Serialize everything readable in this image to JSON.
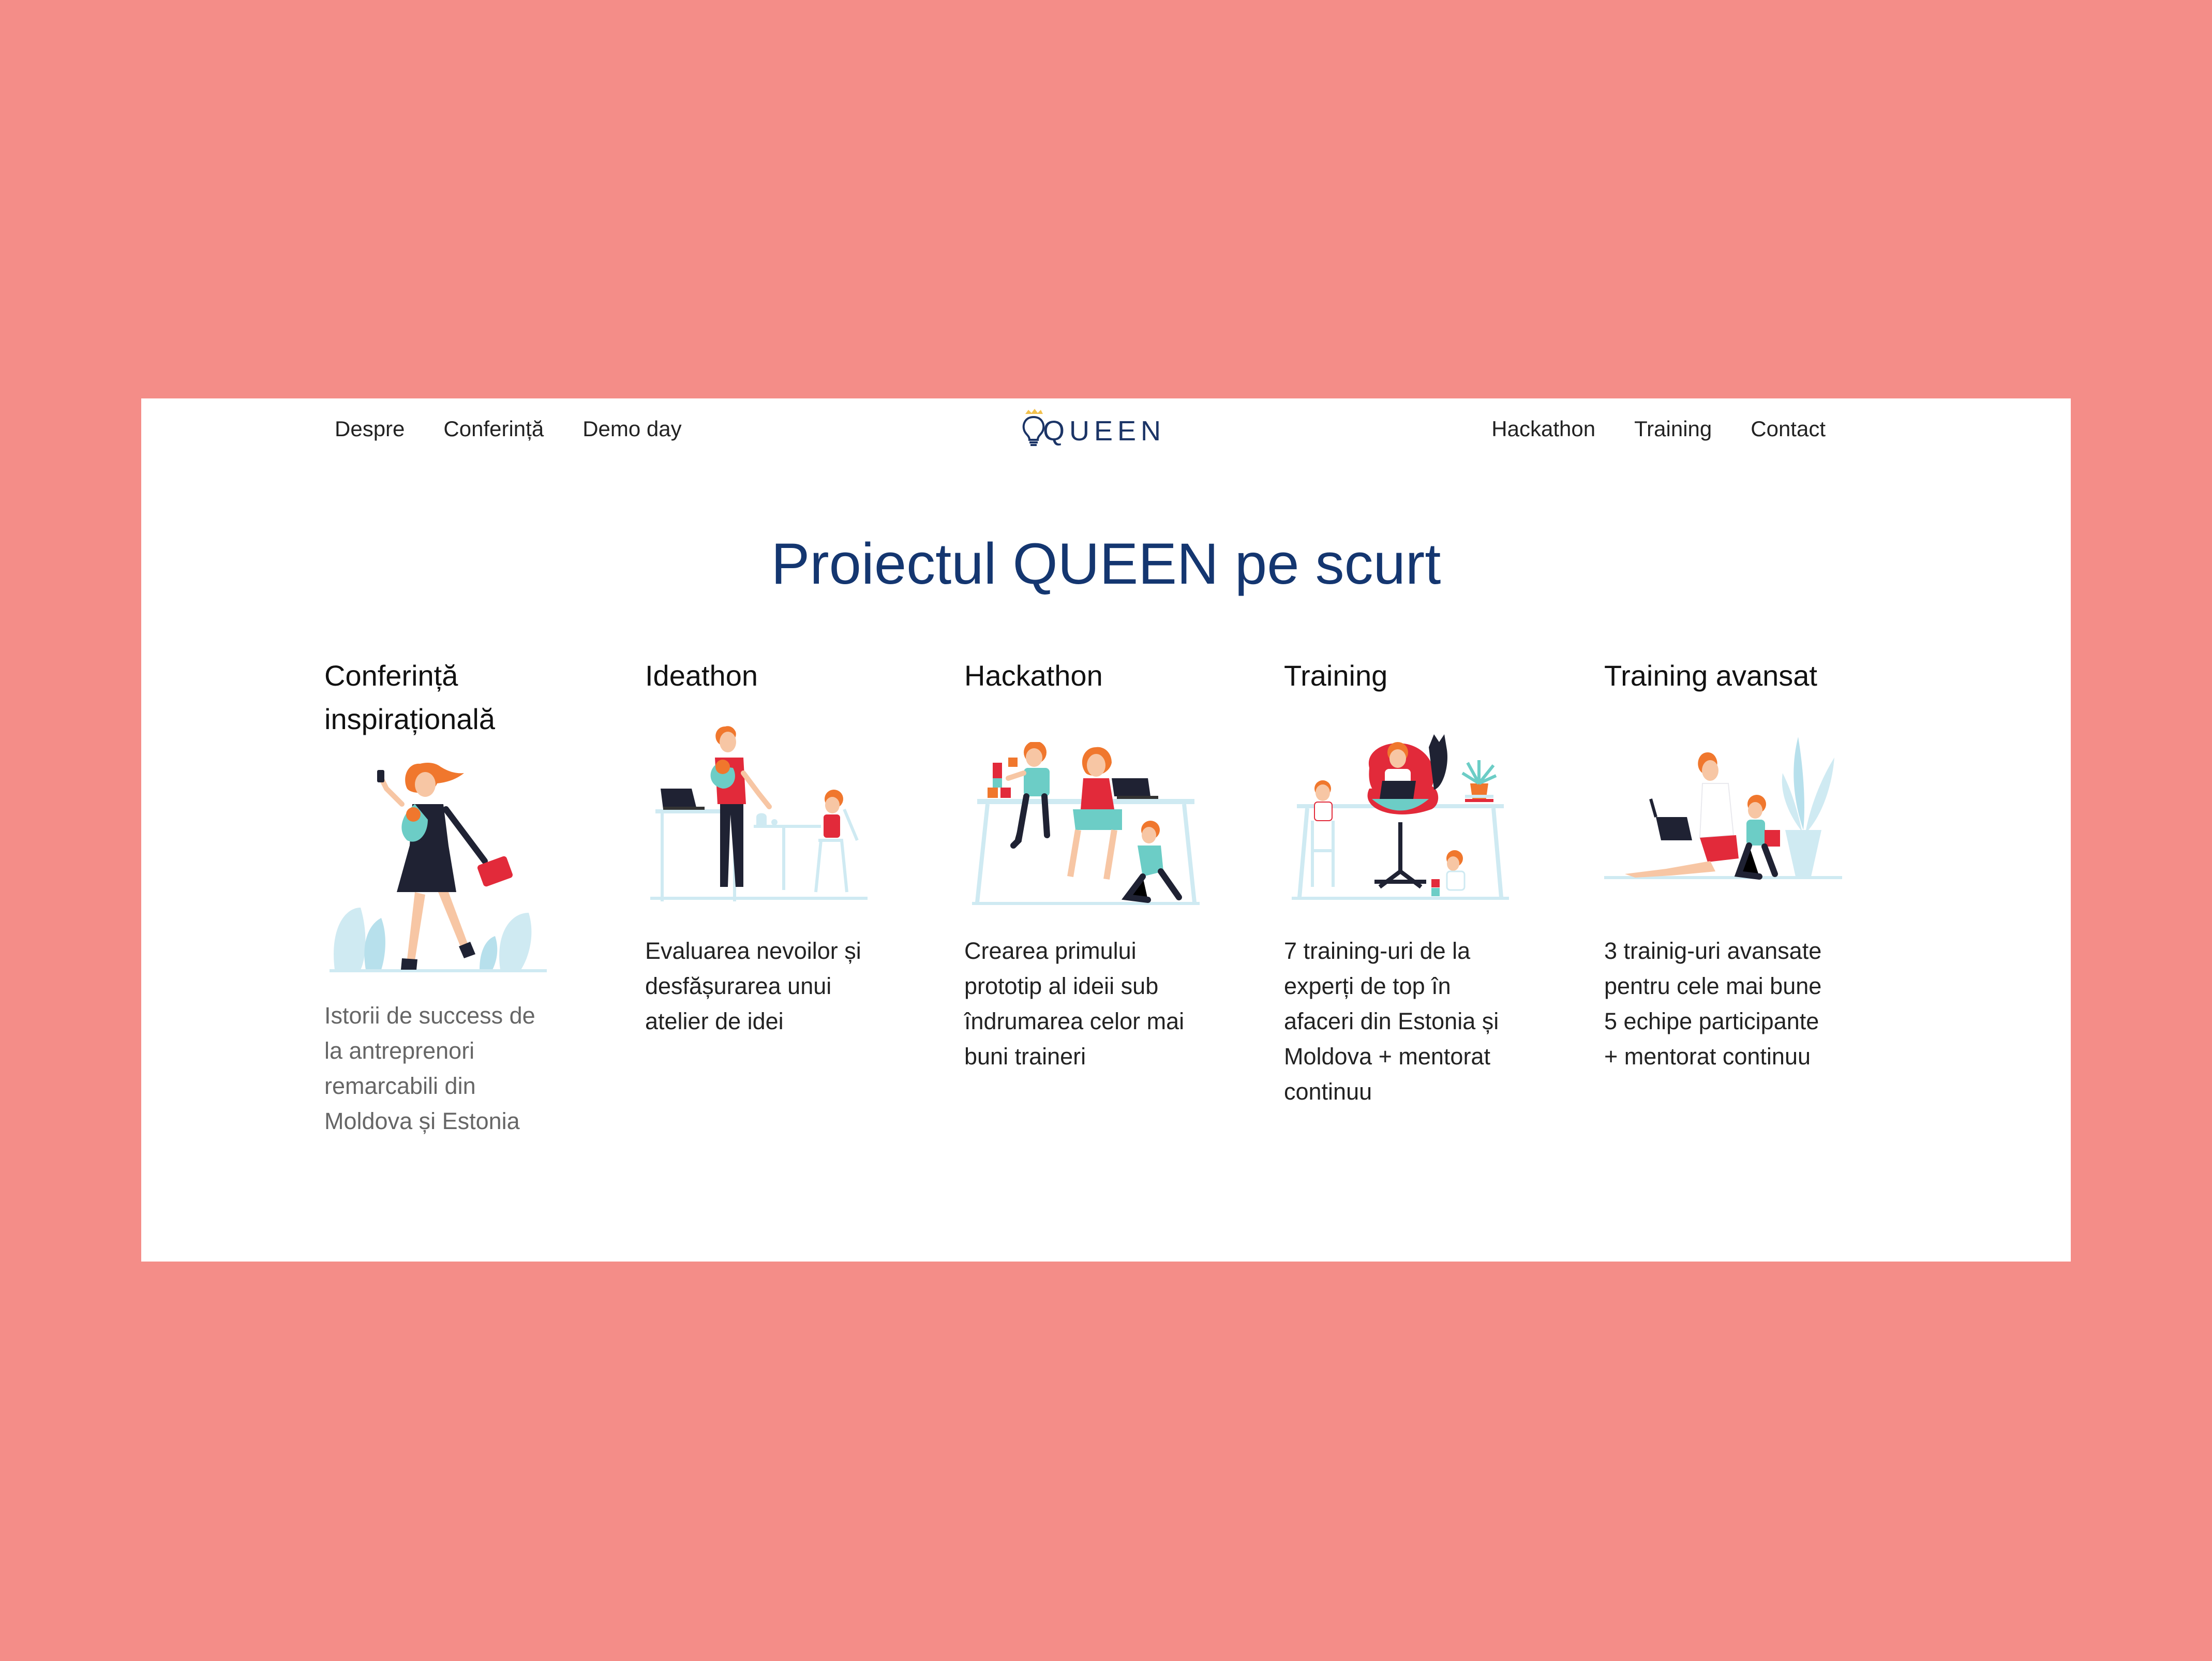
{
  "nav": {
    "left": [
      {
        "label": "Despre"
      },
      {
        "label": "Conferință"
      },
      {
        "label": "Demo day"
      }
    ],
    "right": [
      {
        "label": "Hackathon"
      },
      {
        "label": "Training"
      },
      {
        "label": "Contact"
      }
    ],
    "logo_text": "QUEEN"
  },
  "section": {
    "title": "Proiectul QUEEN pe scurt",
    "items": [
      {
        "title_line1": "Conferință",
        "title_line2": "inspirațională",
        "desc_lines": [
          "Istorii de success de",
          "la antreprenori",
          "remarcabili din",
          "Moldova și Estonia"
        ]
      },
      {
        "title_line1": "Ideathon",
        "desc_lines": [
          "Evaluarea nevoilor și",
          "desfășurarea unui",
          "atelier de idei"
        ]
      },
      {
        "title_line1": "Hackathon",
        "desc_lines": [
          "Crearea primului",
          "prototip al ideii sub",
          "îndrumarea celor mai",
          "buni traineri"
        ]
      },
      {
        "title_line1": "Training",
        "desc_lines": [
          "7 training-uri de la",
          "experți de top în",
          "afaceri din Estonia și",
          "Moldova + mentorat",
          "continuu"
        ]
      },
      {
        "title_line1": "Training avansat",
        "desc_lines": [
          "3 trainig-uri avansate",
          "pentru cele mai bune",
          "5 echipe participante",
          "+ mentorat continuu"
        ]
      }
    ]
  },
  "colors": {
    "background": "#f48d88",
    "title": "#143670",
    "accent_orange": "#f0772d",
    "accent_red": "#e22a3a",
    "accent_teal": "#6ccdc6",
    "light_blue": "#cfeaf2"
  }
}
